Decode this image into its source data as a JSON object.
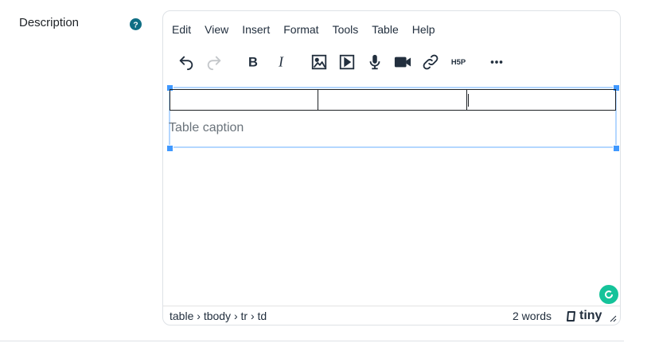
{
  "field": {
    "label": "Description"
  },
  "menubar": {
    "items": [
      "Edit",
      "View",
      "Insert",
      "Format",
      "Tools",
      "Table",
      "Help"
    ]
  },
  "toolbar": {
    "buttons": [
      "undo-icon",
      "redo-icon",
      "bold-icon",
      "italic-icon",
      "image-icon",
      "media-icon",
      "microphone-icon",
      "video-camera-icon",
      "link-icon",
      "h5p-icon",
      "more-icon"
    ]
  },
  "content": {
    "caption": "Table caption"
  },
  "statusbar": {
    "path": [
      "table",
      "tbody",
      "tr",
      "td"
    ],
    "separator": "›",
    "word_count": "2 words",
    "brand": "tiny"
  },
  "colors": {
    "help": "#0f6e84",
    "selection": "#b4d7ff",
    "handle": "#4099ff",
    "grammarly": "#15c39a"
  }
}
